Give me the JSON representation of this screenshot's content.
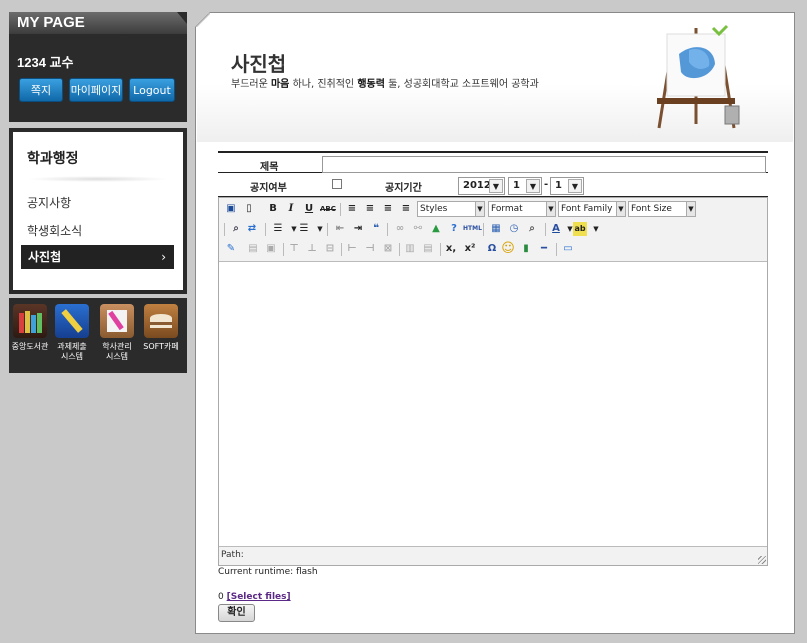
{
  "mypage": {
    "title": "MY PAGE",
    "user": "1234 교수",
    "buttons": {
      "message": "쪽지",
      "mypage": "마이페이지",
      "logout": "Logout"
    }
  },
  "menu": {
    "heading": "학과행정",
    "items": [
      {
        "label": "공지사항",
        "active": false
      },
      {
        "label": "학생회소식",
        "active": false
      },
      {
        "label": "사진첩",
        "active": true
      }
    ],
    "active_chevron": "›"
  },
  "quick_links": [
    {
      "label": "중앙도서관",
      "icon": "library-icon"
    },
    {
      "label": "과제제출\n시스템",
      "icon": "assignment-icon"
    },
    {
      "label": "학사관리\n시스템",
      "icon": "academic-admin-icon"
    },
    {
      "label": "SOFT카페",
      "icon": "cafe-icon"
    }
  ],
  "page": {
    "title": "사진첩",
    "subtitle_pre": "부드러운 ",
    "subtitle_b1": "마음",
    "subtitle_mid": " 하나, 진취적인 ",
    "subtitle_b2": "행동력",
    "subtitle_post": " 둘, 성공회대학교 소프트웨어 공학과"
  },
  "form": {
    "title_label": "제목",
    "title_value": "",
    "notice_label": "공지여부",
    "notice_checked": false,
    "period_label": "공지기간",
    "year": "2012",
    "month": "1",
    "day": "1",
    "date_separator": "-"
  },
  "editor": {
    "toolbar": {
      "styles": "Styles",
      "format": "Format",
      "font_family": "Font Family",
      "font_size": "Font Size"
    },
    "path_label": "Path:",
    "content": ""
  },
  "runtime": "Current runtime: flash",
  "upload": {
    "count": "0",
    "select_files": "[Select files]"
  },
  "confirm_button": "확인"
}
